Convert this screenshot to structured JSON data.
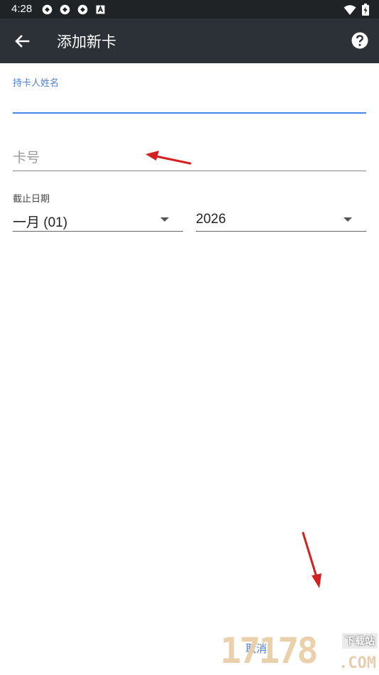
{
  "status_bar": {
    "time": "4:28"
  },
  "toolbar": {
    "title": "添加新卡"
  },
  "form": {
    "cardholder_label": "持卡人姓名",
    "cardholder_value": "",
    "card_number_placeholder": "卡号",
    "expiry_label": "截止日期",
    "month_value": "一月 (01)",
    "year_value": "2026"
  },
  "footer": {
    "cancel_label": "取消"
  },
  "watermark": {
    "digits": "17178",
    "tagline": "下载站",
    "domain": ".COM"
  },
  "colors": {
    "accent": "#4a86e8",
    "toolbar": "#2b3136",
    "statusbar": "#1f2326",
    "annotation_arrow": "#d42020"
  }
}
